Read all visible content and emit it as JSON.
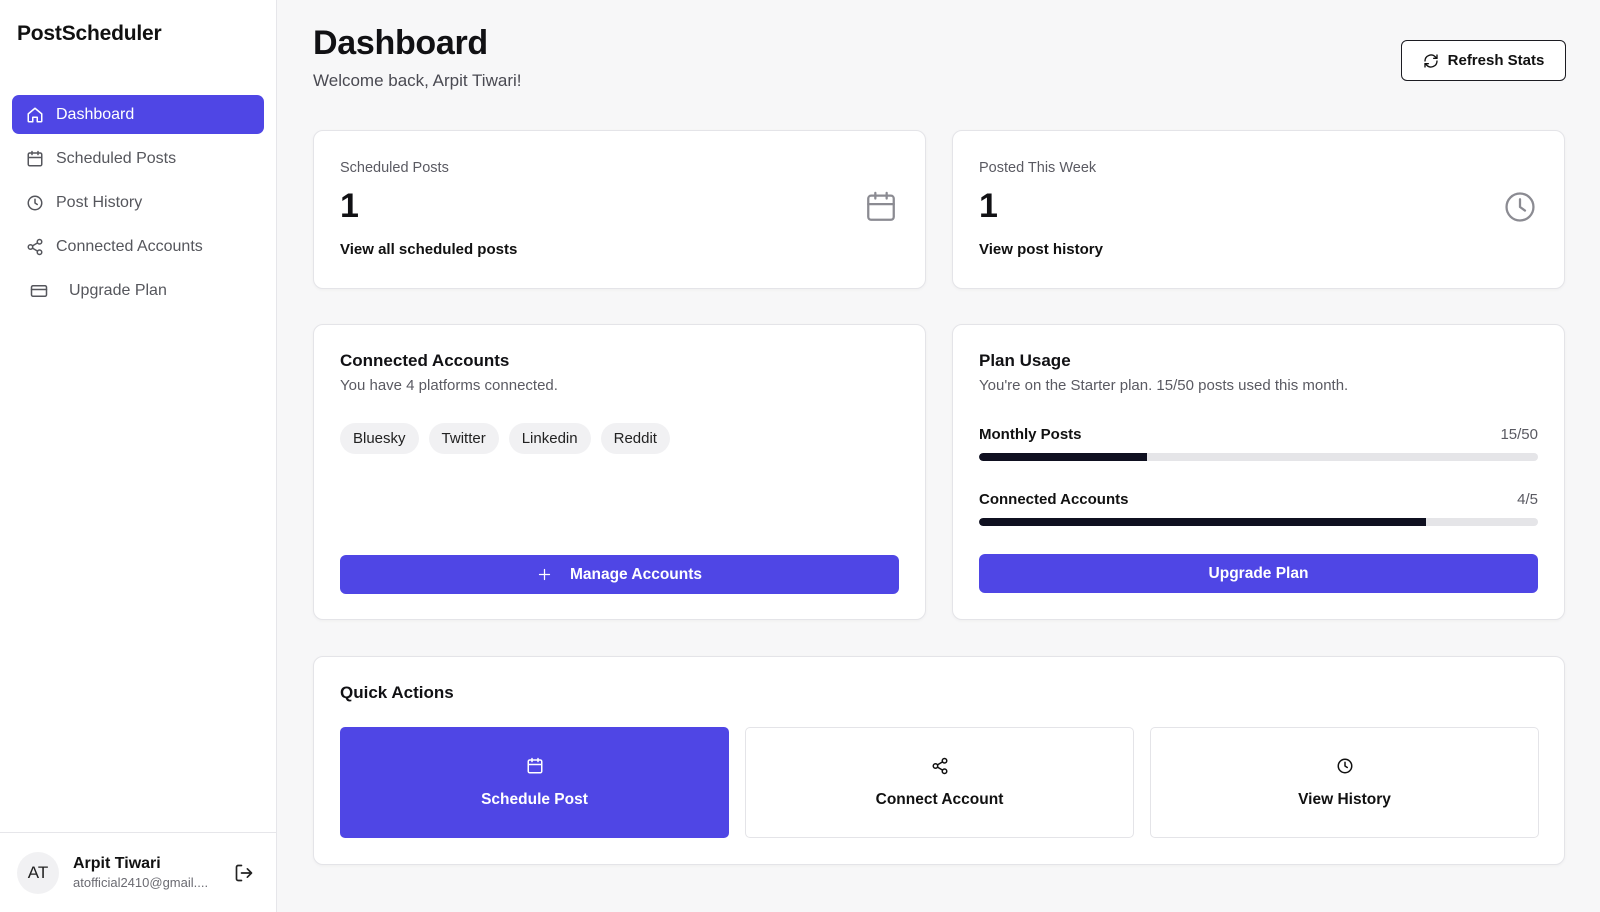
{
  "app": {
    "brand": "PostScheduler"
  },
  "sidebar": {
    "items": [
      {
        "label": "Dashboard",
        "icon": "home-icon",
        "active": true
      },
      {
        "label": "Scheduled Posts",
        "icon": "calendar-icon"
      },
      {
        "label": "Post History",
        "icon": "clock-icon"
      },
      {
        "label": "Connected Accounts",
        "icon": "share-icon"
      },
      {
        "label": "Upgrade Plan",
        "icon": "credit-card-icon"
      }
    ],
    "user": {
      "initials": "AT",
      "name": "Arpit Tiwari",
      "email": "atofficial2410@gmail...."
    }
  },
  "header": {
    "title": "Dashboard",
    "subtitle": "Welcome back, Arpit Tiwari!",
    "refresh_label": "Refresh Stats"
  },
  "stats": {
    "scheduled": {
      "label": "Scheduled Posts",
      "value": "1",
      "link": "View all scheduled posts"
    },
    "posted": {
      "label": "Posted This Week",
      "value": "1",
      "link": "View post history"
    }
  },
  "accounts": {
    "title": "Connected Accounts",
    "desc": "You have 4 platforms connected.",
    "platforms": [
      "Bluesky",
      "Twitter",
      "Linkedin",
      "Reddit"
    ],
    "button": "Manage Accounts"
  },
  "plan": {
    "title": "Plan Usage",
    "desc": "You're on the Starter plan. 15/50 posts used this month.",
    "usage": [
      {
        "label": "Monthly Posts",
        "value": "15/50",
        "fraction": 0.3
      },
      {
        "label": "Connected Accounts",
        "value": "4/5",
        "fraction": 0.8
      }
    ],
    "button": "Upgrade Plan"
  },
  "quick_actions": {
    "title": "Quick Actions",
    "items": [
      {
        "label": "Schedule Post",
        "icon": "calendar-icon"
      },
      {
        "label": "Connect Account",
        "icon": "share-icon"
      },
      {
        "label": "View History",
        "icon": "clock-icon"
      }
    ]
  },
  "colors": {
    "accent": "#4f46e5",
    "bar_fill": "#0f1020",
    "bar_track": "#e5e5e8"
  }
}
